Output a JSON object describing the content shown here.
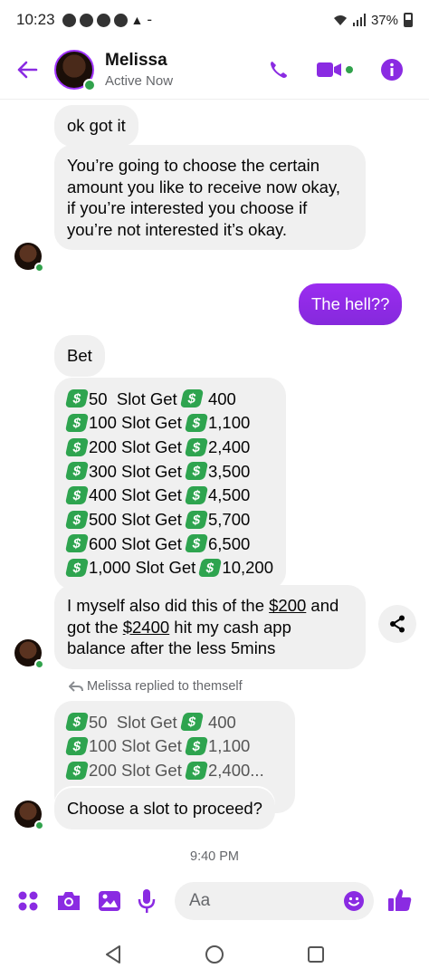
{
  "status_bar": {
    "time": "10:23",
    "battery": "37%"
  },
  "header": {
    "name": "Melissa",
    "status": "Active Now"
  },
  "messages": [
    {
      "text": "ok got it"
    },
    {
      "text": "You’re going to choose the certain amount you like to receive now okay, if you’re interested you choose if you’re not interested it’s okay."
    },
    {
      "text": "The hell??"
    },
    {
      "text": "Bet"
    }
  ],
  "slots": [
    {
      "slot": "50",
      "label": "Slot Get",
      "get": "400"
    },
    {
      "slot": "100",
      "label": "Slot Get",
      "get": "1,100"
    },
    {
      "slot": "200",
      "label": "Slot Get",
      "get": "2,400"
    },
    {
      "slot": "300",
      "label": "Slot Get",
      "get": "3,500"
    },
    {
      "slot": "400",
      "label": "Slot Get",
      "get": "4,500"
    },
    {
      "slot": "500",
      "label": "Slot Get",
      "get": "5,700"
    },
    {
      "slot": "600",
      "label": "Slot Get",
      "get": "6,500"
    },
    {
      "slot": "1,000",
      "label": "Slot Get",
      "get": "10,200"
    }
  ],
  "proof_message": {
    "part1": "I myself also did this of the ",
    "amount1": "$200",
    "part2": " and got the ",
    "amount2": "$2400",
    "part3": " hit my cash app balance after the less 5mins"
  },
  "reply_note": "Melissa replied to themself",
  "quoted_slots": [
    {
      "slot": "50",
      "label": "Slot Get",
      "get": "400"
    },
    {
      "slot": "100",
      "label": "Slot Get",
      "get": "1,100"
    },
    {
      "slot": "200",
      "label": "Slot Get",
      "get": "2,400..."
    }
  ],
  "last_message": "Choose a slot to proceed?",
  "timestamp": "9:40 PM",
  "composer": {
    "placeholder": "Aa"
  },
  "colors": {
    "accent": "#8a2be2",
    "online": "#31a24c",
    "money": "#2ea44f",
    "incoming_bubble": "#f0f0f0"
  },
  "icons": [
    "back-arrow-icon",
    "phone-icon",
    "video-icon",
    "info-icon",
    "apps-icon",
    "camera-icon",
    "image-icon",
    "mic-icon",
    "emoji-icon",
    "like-icon",
    "share-icon",
    "money-icon",
    "reply-icon"
  ]
}
